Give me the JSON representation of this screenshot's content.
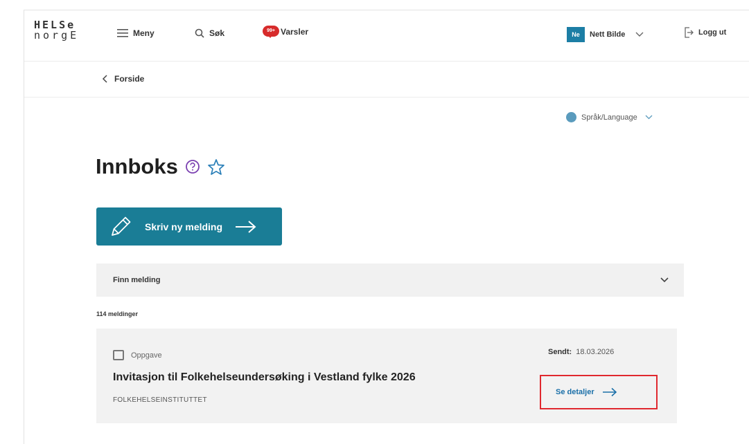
{
  "header": {
    "logo_line1": "HELSe",
    "logo_line2": "norgE",
    "menu_label": "Meny",
    "search_label": "Søk",
    "notifications_label": "Varsler",
    "notifications_badge": "99+",
    "user_initials": "Ne",
    "user_name": "Nett Bilde",
    "logout_label": "Logg ut"
  },
  "breadcrumb": {
    "label": "Forside"
  },
  "language": {
    "label": "Språk/Language"
  },
  "page": {
    "title": "Innboks"
  },
  "actions": {
    "new_message_label": "Skriv ny melding"
  },
  "search": {
    "label": "Finn melding"
  },
  "inbox": {
    "count_label": "114 meldinger",
    "messages": [
      {
        "type": "Oppgave",
        "title": "Invitasjon til Folkehelseundersøking i Vestland fylke 2026",
        "sender": "FOLKEHELSEINSTITUTTET",
        "sent_label": "Sendt:",
        "sent_date": "18.03.2026",
        "details_label": "Se detaljer"
      }
    ]
  },
  "colors": {
    "primary": "#1a7d96",
    "badge": "#d72b2b",
    "highlight": "#e0282e",
    "link": "#1a6fa8",
    "help_icon": "#7a3fb0",
    "star_icon": "#2a7fb8"
  }
}
